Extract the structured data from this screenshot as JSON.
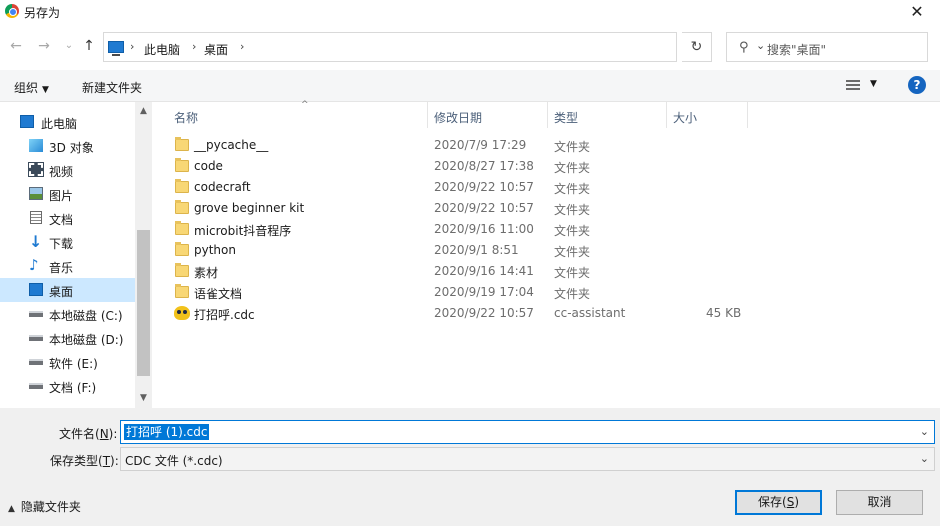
{
  "window": {
    "title": "另存为",
    "close_glyph": "✕"
  },
  "nav": {
    "back_glyph": "←",
    "forward_glyph": "→",
    "recent_glyph": "⌄",
    "up_glyph": "↑",
    "breadcrumb": [
      "此电脑",
      "桌面"
    ],
    "dropdown_glyph": "⌄",
    "refresh_glyph": "↻",
    "search_placeholder": "搜索\"桌面\"",
    "search_glyph": "⚲"
  },
  "toolbar": {
    "organize": "组织",
    "organize_arrow": "▼",
    "new_folder": "新建文件夹",
    "view_arrow": "▼",
    "help": "?"
  },
  "sidebar": {
    "items": [
      {
        "label": "此电脑",
        "icon": "pc-icon"
      },
      {
        "label": "3D 对象",
        "icon": "cube-icon"
      },
      {
        "label": "视频",
        "icon": "video-icon"
      },
      {
        "label": "图片",
        "icon": "picture-icon"
      },
      {
        "label": "文档",
        "icon": "document-icon"
      },
      {
        "label": "下载",
        "icon": "download-icon"
      },
      {
        "label": "音乐",
        "icon": "music-icon"
      },
      {
        "label": "桌面",
        "icon": "desktop-icon",
        "selected": true
      },
      {
        "label": "本地磁盘 (C:)",
        "icon": "drive-icon"
      },
      {
        "label": "本地磁盘 (D:)",
        "icon": "drive-icon"
      },
      {
        "label": "软件 (E:)",
        "icon": "drive-icon"
      },
      {
        "label": "文档 (F:)",
        "icon": "drive-icon"
      }
    ],
    "scroll_up": "▲",
    "scroll_down": "▼"
  },
  "files": {
    "columns": {
      "name": "名称",
      "date": "修改日期",
      "type": "类型",
      "size": "大小"
    },
    "sort_caret": "^",
    "rows": [
      {
        "name": "__pycache__",
        "date": "2020/7/9 17:29",
        "type": "文件夹",
        "size": "",
        "kind": "folder"
      },
      {
        "name": "code",
        "date": "2020/8/27 17:38",
        "type": "文件夹",
        "size": "",
        "kind": "folder"
      },
      {
        "name": "codecraft",
        "date": "2020/9/22 10:57",
        "type": "文件夹",
        "size": "",
        "kind": "folder"
      },
      {
        "name": "grove beginner kit",
        "date": "2020/9/22 10:57",
        "type": "文件夹",
        "size": "",
        "kind": "folder"
      },
      {
        "name": "microbit抖音程序",
        "date": "2020/9/16 11:00",
        "type": "文件夹",
        "size": "",
        "kind": "folder"
      },
      {
        "name": "python",
        "date": "2020/9/1 8:51",
        "type": "文件夹",
        "size": "",
        "kind": "folder"
      },
      {
        "name": "素材",
        "date": "2020/9/16 14:41",
        "type": "文件夹",
        "size": "",
        "kind": "folder"
      },
      {
        "name": "语雀文档",
        "date": "2020/9/19 17:04",
        "type": "文件夹",
        "size": "",
        "kind": "folder"
      },
      {
        "name": "打招呼.cdc",
        "date": "2020/9/22 10:57",
        "type": "cc-assistant",
        "size": "45 KB",
        "kind": "cdc"
      }
    ]
  },
  "footer": {
    "filename_label": "文件名(",
    "filename_key": "N",
    "filename_label_end": "):",
    "filename_value": "打招呼 (1).cdc",
    "filetype_label": "保存类型(",
    "filetype_key": "T",
    "filetype_label_end": "):",
    "filetype_value": "CDC 文件 (*.cdc)",
    "dropdown_glyph": "⌄",
    "hide_folders": "隐藏文件夹",
    "hide_caret": "▲",
    "save": "保存(",
    "save_key": "S",
    "save_end": ")",
    "cancel": "取消"
  },
  "colors": {
    "accent": "#0078d7",
    "selection": "#cce8ff",
    "folder": "#f8d775",
    "help": "#1565c0"
  }
}
